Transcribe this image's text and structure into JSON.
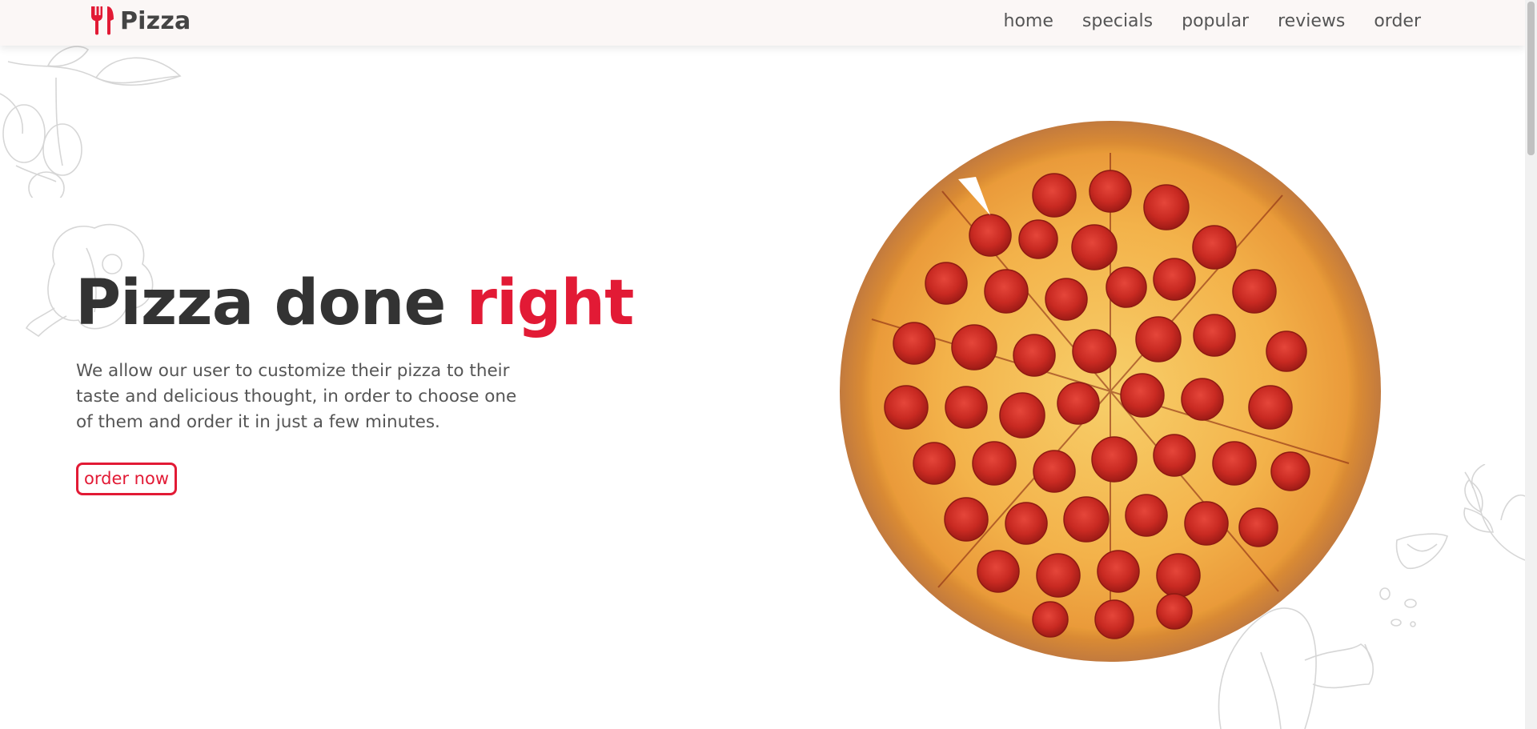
{
  "header": {
    "logo_text": "Pizza",
    "logo_icon": "utensils-icon",
    "nav": [
      "home",
      "specials",
      "popular",
      "reviews",
      "order"
    ]
  },
  "hero": {
    "title_main": "Pizza done ",
    "title_accent": "right",
    "description": "We allow our user to customize their pizza to their taste and delicious thought, in order to choose one of them and order it in just a few minutes.",
    "cta_label": "order now"
  },
  "colors": {
    "accent": "#e21a35",
    "header_bg": "#fbf7f6",
    "text_dark": "#333333",
    "text_muted": "#555555"
  }
}
